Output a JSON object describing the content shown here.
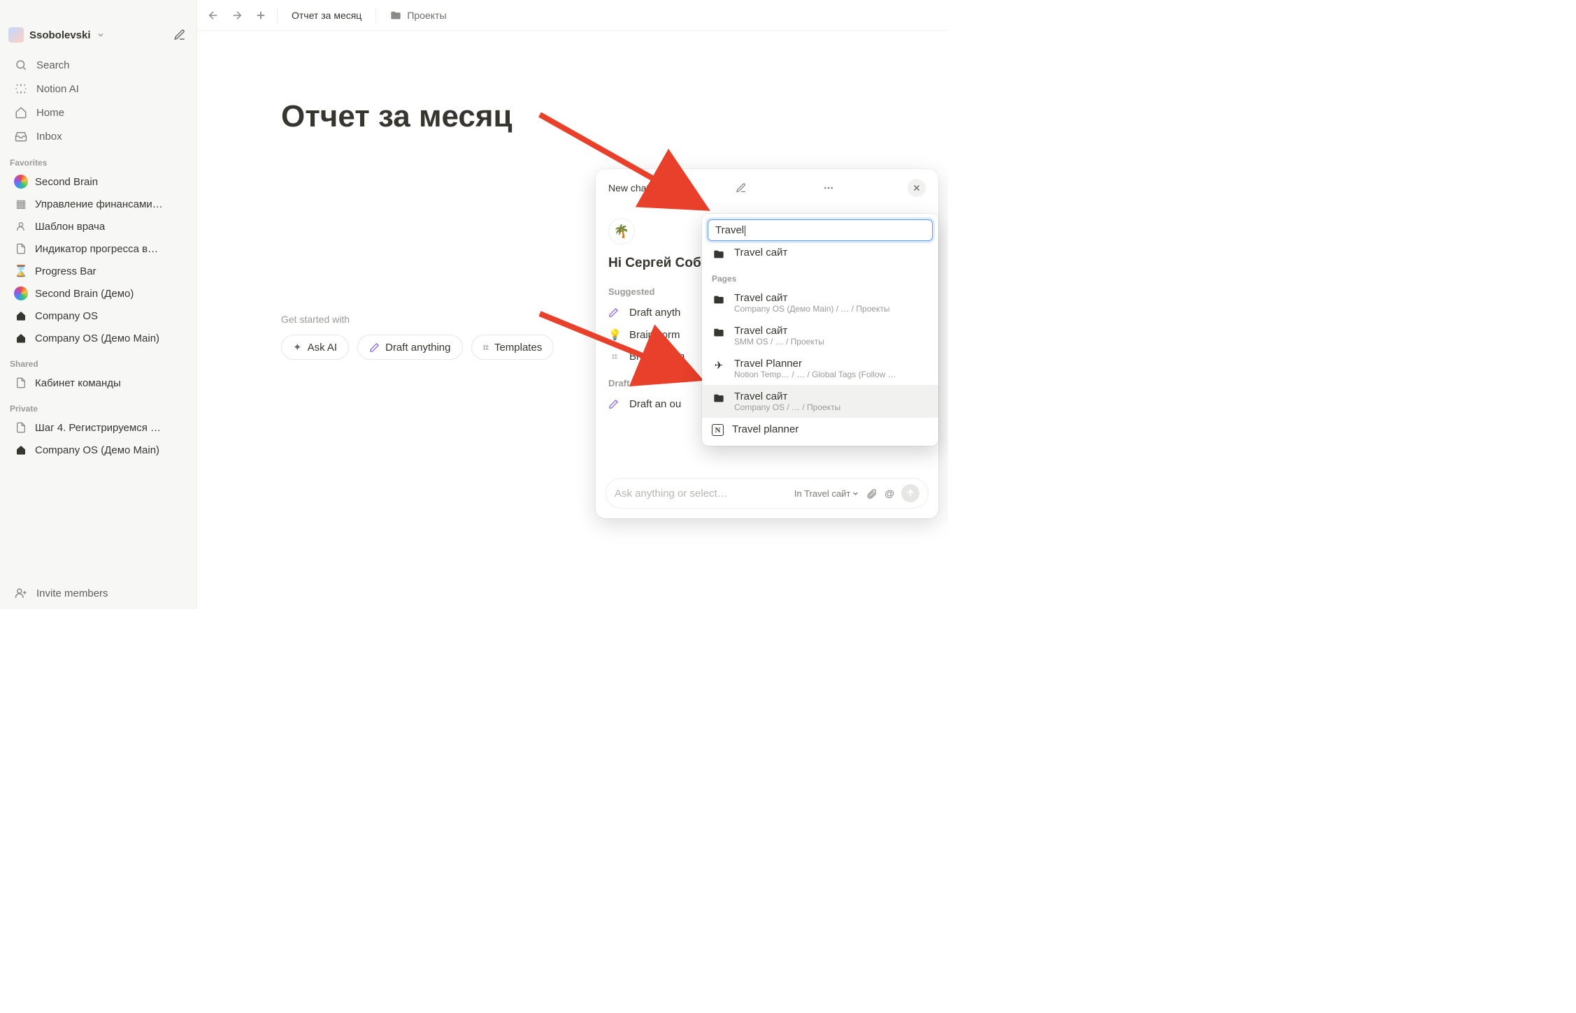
{
  "workspace": {
    "name": "Ssobolevski"
  },
  "nav": {
    "search": "Search",
    "notion_ai": "Notion AI",
    "home": "Home",
    "inbox": "Inbox"
  },
  "sections": {
    "favorites": "Favorites",
    "shared": "Shared",
    "private": "Private"
  },
  "favorites": [
    {
      "icon": "rainbow",
      "label": "Second Brain"
    },
    {
      "icon": "gallery",
      "label": "Управление финансами…"
    },
    {
      "icon": "user",
      "label": "Шаблон врача"
    },
    {
      "icon": "page",
      "label": "Индикатор прогресса в…"
    },
    {
      "icon": "hourglass",
      "label": "Progress Bar"
    },
    {
      "icon": "rainbow",
      "label": "Second Brain (Демо)"
    },
    {
      "icon": "home",
      "label": "Company OS"
    },
    {
      "icon": "home",
      "label": "Company OS (Демо Main)"
    }
  ],
  "shared": [
    {
      "icon": "page",
      "label": "Кабинет команды"
    }
  ],
  "private": [
    {
      "icon": "page",
      "label": "Шаг 4. Регистрируемся …"
    },
    {
      "icon": "home",
      "label": "Company OS (Демо Main)"
    }
  ],
  "invite": "Invite members",
  "tabs": {
    "current": "Отчет за месяц",
    "second": "Проекты"
  },
  "page": {
    "title": "Отчет за месяц",
    "get_started": "Get started with",
    "chips": {
      "ask_ai": "Ask AI",
      "draft": "Draft anything",
      "templates": "Templates"
    }
  },
  "ai": {
    "header": "New chat",
    "logo": "🌴",
    "greeting": "Hi Сергей Соб",
    "suggested_label": "Suggested",
    "suggested": [
      {
        "icon": "pencil",
        "label": "Draft anyth"
      },
      {
        "icon": "bulb",
        "label": "Brainstorm"
      },
      {
        "icon": "grid",
        "label": "Browse tem"
      }
    ],
    "draft_label": "Draft",
    "draft_items": [
      {
        "icon": "pencil",
        "label": "Draft an ou"
      }
    ],
    "placeholder": "Ask anything or select…",
    "context": "In Travel сайт"
  },
  "popup": {
    "input": "Travel",
    "top_option": {
      "label": "Travel сайт"
    },
    "pages_label": "Pages",
    "results": [
      {
        "icon": "folder",
        "title": "Travel сайт",
        "sub": "Company OS (Демо Main) / … / Проекты"
      },
      {
        "icon": "folder",
        "title": "Travel сайт",
        "sub": "SMM OS / … / Проекты"
      },
      {
        "icon": "plane",
        "title": "Travel Planner",
        "sub": "Notion Temp… / … / Global Tags (Follow …"
      },
      {
        "icon": "folder",
        "title": "Travel сайт",
        "sub": "Company OS / … / Проекты",
        "selected": true
      },
      {
        "icon": "notion",
        "title": "Travel planner",
        "sub": ""
      }
    ]
  }
}
